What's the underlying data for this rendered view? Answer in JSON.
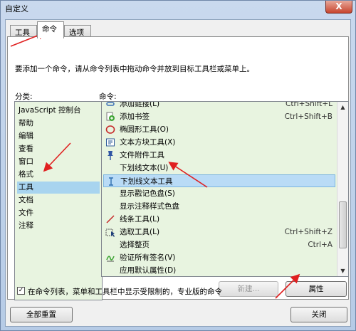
{
  "window": {
    "title": "自定义",
    "close_glyph": "X"
  },
  "tabs": [
    {
      "label": "工具栏"
    },
    {
      "label": "命令"
    },
    {
      "label": "选项"
    }
  ],
  "hint": "要添加一个命令，请从命令列表中拖动命令并放到目标工具栏或菜单上。",
  "categories_label": "分类:",
  "commands_label": "命令:",
  "categories": [
    {
      "label": "JavaScript 控制台"
    },
    {
      "label": "帮助"
    },
    {
      "label": "编辑"
    },
    {
      "label": "查看"
    },
    {
      "label": "窗口"
    },
    {
      "label": "格式"
    },
    {
      "label": "工具",
      "selected": true
    },
    {
      "label": "文档"
    },
    {
      "label": "文件"
    },
    {
      "label": "注释"
    }
  ],
  "commands": [
    {
      "label": "添加链接(L)",
      "shortcut": "Ctrl+Shift+L",
      "icon": "link-icon"
    },
    {
      "label": "添加书签",
      "shortcut": "Ctrl+Shift+B",
      "icon": "bookmark-icon"
    },
    {
      "label": "椭圆形工具(O)",
      "shortcut": "",
      "icon": "ellipse-icon"
    },
    {
      "label": "文本方块工具(X)",
      "shortcut": "",
      "icon": "textbox-icon"
    },
    {
      "label": "文件附件工具",
      "shortcut": "",
      "icon": "pushpin-icon"
    },
    {
      "label": "下划线文本(U)",
      "shortcut": "",
      "icon": ""
    },
    {
      "label": "下划线文本工具",
      "shortcut": "",
      "icon": "text-cursor-icon",
      "selected": true
    },
    {
      "label": "显示戳记色盘(S)",
      "shortcut": "",
      "icon": ""
    },
    {
      "label": "显示注释样式色盘",
      "shortcut": "",
      "icon": ""
    },
    {
      "label": "线条工具(L)",
      "shortcut": "",
      "icon": "line-icon"
    },
    {
      "label": "选取工具(L)",
      "shortcut": "Ctrl+Shift+Z",
      "icon": "select-icon"
    },
    {
      "label": "选择整页",
      "shortcut": "Ctrl+A",
      "icon": ""
    },
    {
      "label": "验证所有签名(V)",
      "shortcut": "",
      "icon": "signature-icon"
    },
    {
      "label": "应用默认属性(D)",
      "shortcut": "",
      "icon": ""
    }
  ],
  "buttons": {
    "new": "新建...",
    "properties": "属性",
    "reset_all": "全部重置",
    "close": "关闭"
  },
  "checkbox": {
    "label": "在命令列表，菜单和工具栏中显示受限制的，专业版的命令",
    "checked": true,
    "mark": "✓"
  },
  "colors": {
    "annotation_arrow": "#e02020",
    "selection": "#a8d4ef",
    "list_bg": "#e8f4e0"
  }
}
